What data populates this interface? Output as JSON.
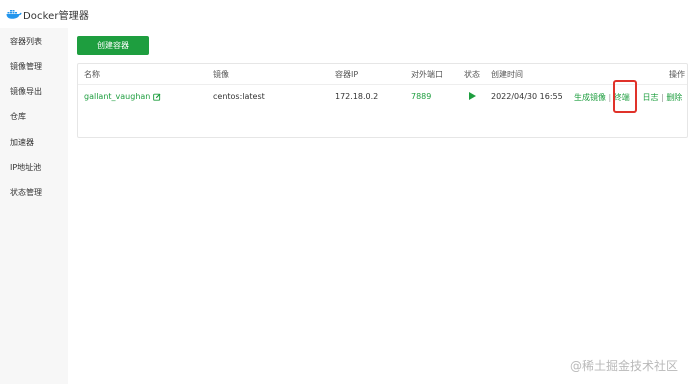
{
  "app": {
    "title": "Docker管理器"
  },
  "sidebar": {
    "items": [
      {
        "label": "容器列表"
      },
      {
        "label": "镜像管理"
      },
      {
        "label": "镜像导出"
      },
      {
        "label": "仓库"
      },
      {
        "label": "加速器"
      },
      {
        "label": "IP地址池"
      },
      {
        "label": "状态管理"
      }
    ]
  },
  "toolbar": {
    "create_label": "创建容器"
  },
  "table": {
    "headers": {
      "name": "名称",
      "image": "镜像",
      "ip": "容器IP",
      "port": "对外端口",
      "status": "状态",
      "created": "创建时间",
      "actions": "操作"
    },
    "rows": [
      {
        "name": "gallant_vaughan",
        "image": "centos:latest",
        "ip": "172.18.0.2",
        "port": "7889",
        "created": "2022/04/30 16:55",
        "actions": {
          "generate_image": "生成镜像",
          "terminal": "终端",
          "log": "日志",
          "delete": "删除"
        }
      }
    ]
  },
  "separator": "|",
  "watermark": "@稀土掘金技术社区",
  "colors": {
    "accent": "#1e9e3f",
    "highlight": "#e0322a"
  }
}
